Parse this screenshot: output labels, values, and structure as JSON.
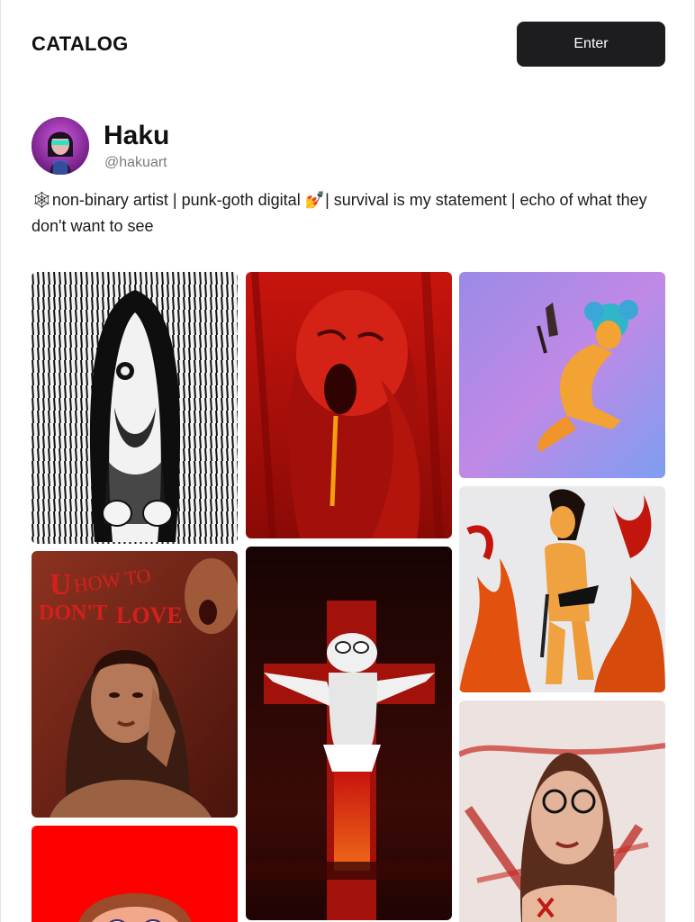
{
  "header": {
    "logo": "CATALOG",
    "enter_label": "Enter"
  },
  "profile": {
    "name": "Haku",
    "handle": "@hakuart",
    "bio_icon_1": "🕸",
    "bio_part_1": "non-binary artist | punk-goth digital ",
    "bio_icon_2": "💅",
    "bio_part_2": "| survival is my statement | echo of what they don't want to see"
  },
  "gallery": {
    "items": [
      {
        "name": "ink-long-hair-figure",
        "palette": [
          "#ffffff",
          "#111111"
        ]
      },
      {
        "name": "red-screaming-face",
        "palette": [
          "#c1120c",
          "#3a0504"
        ]
      },
      {
        "name": "lavender-knife-figure",
        "palette": [
          "#a67ee8",
          "#f0a33a"
        ]
      },
      {
        "name": "u-how-to-dont-love",
        "palette": [
          "#7a2416",
          "#c94a2a"
        ],
        "text": "U HOW TO DON'T LOVE"
      },
      {
        "name": "red-cross-frog",
        "palette": [
          "#1a0707",
          "#c81e14"
        ]
      },
      {
        "name": "fire-figure",
        "palette": [
          "#e8e8ea",
          "#e85d10"
        ]
      },
      {
        "name": "red-bg-portrait",
        "palette": [
          "#ff0000",
          "#f2a37a"
        ]
      },
      {
        "name": "glasses-portrait",
        "palette": [
          "#efe6e4",
          "#b4201b"
        ]
      }
    ]
  }
}
